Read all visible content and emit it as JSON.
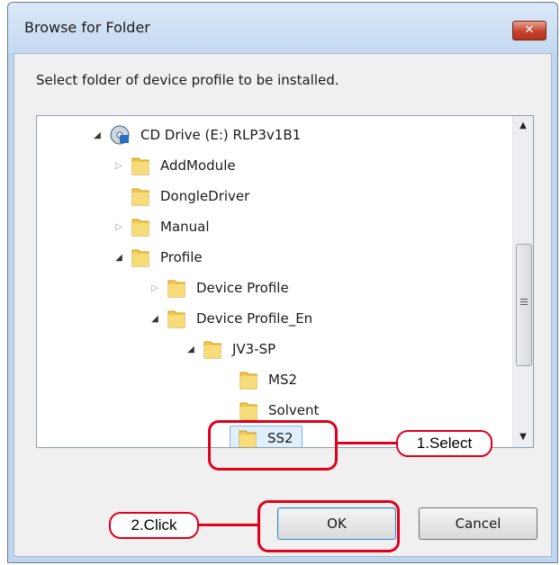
{
  "window": {
    "title": "Browse for Folder",
    "close_glyph": "✕"
  },
  "prompt": "Select folder of device profile to be installed.",
  "tree": {
    "items": [
      {
        "label": "CD Drive (E:) RLP3v1B1",
        "icon": "cd-drive-icon",
        "expander": "expanded"
      },
      {
        "label": "AddModule",
        "icon": "folder-icon",
        "expander": "collapsed"
      },
      {
        "label": "DongleDriver",
        "icon": "folder-icon",
        "expander": "none"
      },
      {
        "label": "Manual",
        "icon": "folder-icon",
        "expander": "collapsed"
      },
      {
        "label": "Profile",
        "icon": "folder-icon",
        "expander": "expanded"
      },
      {
        "label": "Device Profile",
        "icon": "folder-icon",
        "expander": "collapsed"
      },
      {
        "label": "Device Profile_En",
        "icon": "folder-icon",
        "expander": "expanded"
      },
      {
        "label": "JV3-SP",
        "icon": "folder-icon",
        "expander": "expanded"
      },
      {
        "label": "MS2",
        "icon": "folder-icon",
        "expander": "none"
      },
      {
        "label": "Solvent",
        "icon": "folder-icon",
        "expander": "none"
      },
      {
        "label": "SS2",
        "icon": "folder-icon",
        "expander": "none",
        "selected": true
      }
    ]
  },
  "scrollbar": {
    "up_glyph": "▲",
    "down_glyph": "▼"
  },
  "buttons": {
    "ok": "OK",
    "cancel": "Cancel"
  },
  "annotations": {
    "select": "1.Select",
    "click": "2.Click"
  },
  "colors": {
    "annotation_red": "#e0001b",
    "selection": "#dff0fc",
    "folder_yellow": "#f2c94c"
  }
}
